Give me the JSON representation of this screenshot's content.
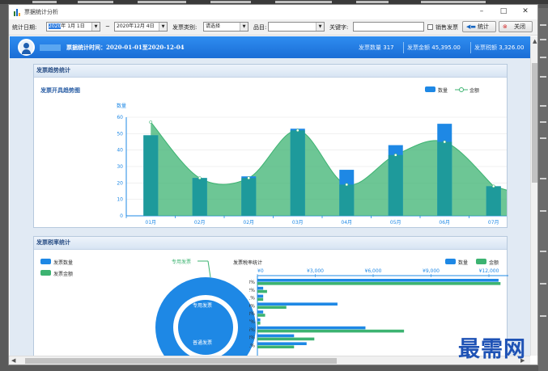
{
  "window": {
    "title": "票据统计分析",
    "controls": [
      "–",
      "□",
      "✕"
    ]
  },
  "toolbar": {
    "date_label": "统计日期:",
    "start_date": {
      "year": "2020",
      "rest": "年 1月 1日"
    },
    "tilde": "~",
    "end_date": "2020年12月 4日",
    "type_label": "发票类别:",
    "type_value": "请选择",
    "product_label": "品目:",
    "product_value": "",
    "keyword_label": "关键字:",
    "keyword_value": "",
    "sales_invoice_label": "销售发票",
    "stats_button": "统计",
    "close_button": "关闭"
  },
  "header": {
    "period": "票据统计时间：2020-01-01至2020-12-04",
    "count_label": "发票数量",
    "count_value": "317",
    "amount_label": "发票金额",
    "amount_value": "45,395.00",
    "tax_label": "发票税额",
    "tax_value": "3,326.00"
  },
  "trend": {
    "panel_title": "发票趋势统计",
    "chart_title": "发票开具趋势图",
    "legend_count": "数量",
    "legend_amount": "金额",
    "colors": {
      "count": "#1e88e5",
      "amount": "#3cb371",
      "overlap": "#1f9e8e"
    }
  },
  "tax": {
    "panel_title": "发票税率统计",
    "legend_count": "发票数量",
    "legend_amount": "发票金额",
    "donut_outer_label": "专用发票",
    "donut_inner_top": "专用发票",
    "donut_inner_bottom": "普通发票",
    "bar_title": "发票税率统计",
    "bar_legend_count": "数量",
    "bar_legend_amount": "金额"
  },
  "watermark": "最需网",
  "chart_data": [
    {
      "type": "bar",
      "title": "发票开具趋势图",
      "ylabel": "数量",
      "categories": [
        "01月",
        "02月",
        "02月",
        "03月",
        "04月",
        "05月",
        "06月",
        "07月"
      ],
      "ylim": [
        0,
        60
      ],
      "yticks": [
        0,
        10,
        20,
        30,
        40,
        50,
        60
      ],
      "series": [
        {
          "name": "数量",
          "values": [
            49,
            23,
            24,
            53,
            28,
            43,
            56,
            18
          ]
        },
        {
          "name": "金额",
          "values": [
            57,
            23,
            23,
            52,
            19,
            37,
            45,
            18
          ]
        }
      ],
      "grid": true,
      "legend": "top-right"
    },
    {
      "type": "bar",
      "title": "发票税率统计",
      "orientation": "horizontal",
      "categories": [
        "13%",
        "12%",
        "11%",
        "9%",
        "8%",
        "7%",
        "6%",
        "3%",
        "1%"
      ],
      "xticks": [
        "¥0",
        "¥3,000",
        "¥6,000",
        "¥9,000",
        "¥12,000"
      ],
      "xlim": [
        0,
        12000
      ],
      "series": [
        {
          "name": "数量",
          "values": [
            12500,
            300,
            300,
            4150,
            300,
            150,
            5600,
            1900,
            2550
          ]
        },
        {
          "name": "金额",
          "values": [
            12600,
            500,
            300,
            1500,
            400,
            150,
            7600,
            2950,
            1900
          ]
        }
      ],
      "legend": "top-right"
    }
  ]
}
